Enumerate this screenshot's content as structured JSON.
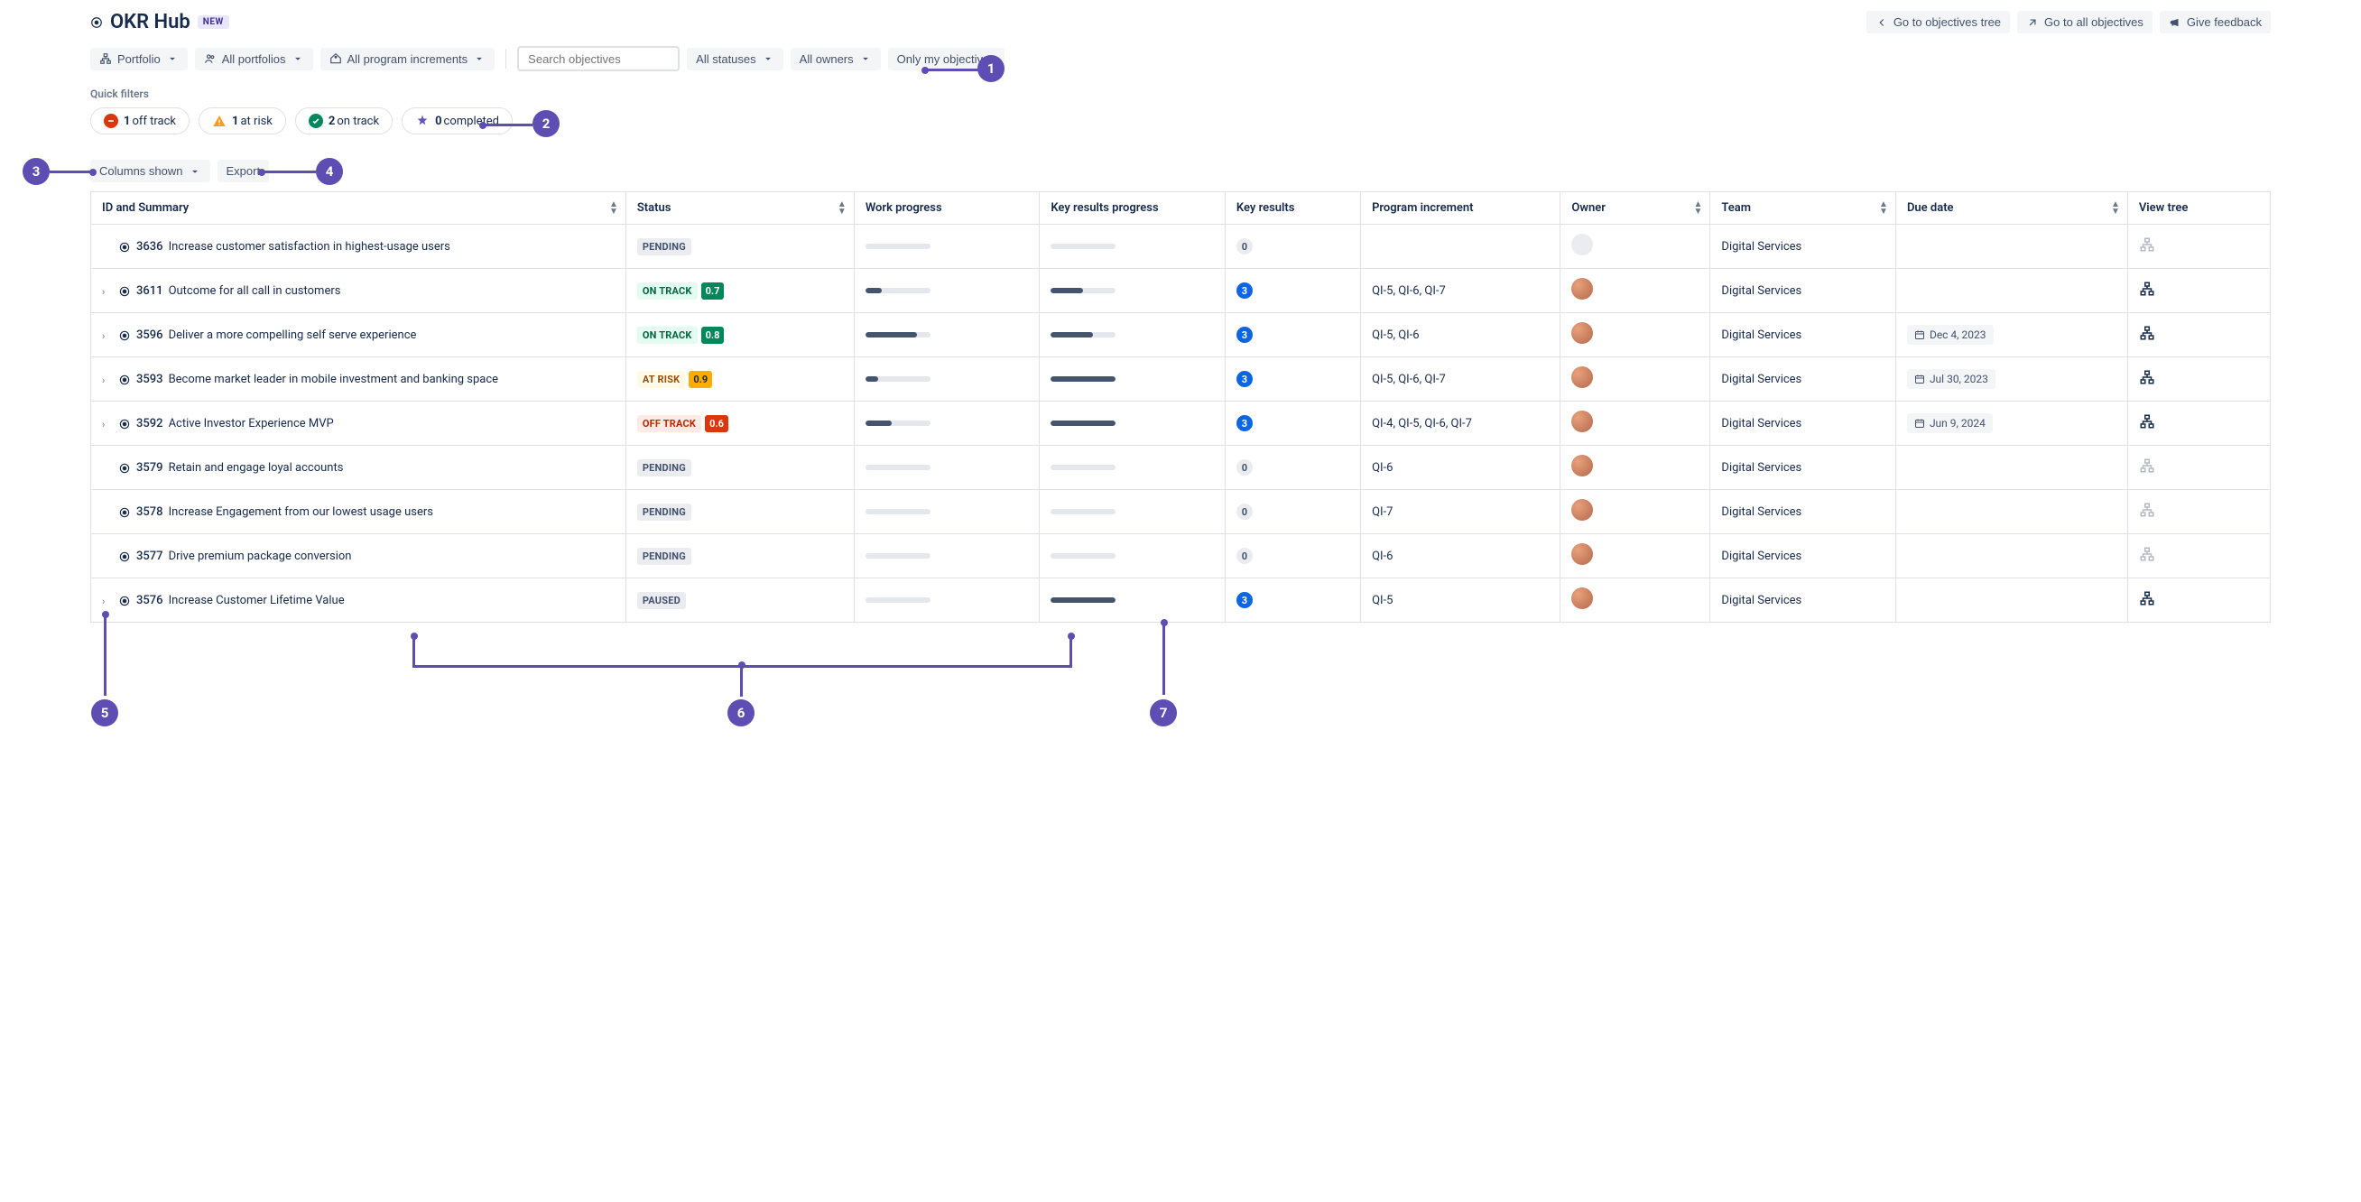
{
  "header": {
    "title": "OKR Hub",
    "new_badge": "NEW",
    "actions": {
      "objectives_tree": "Go to objectives tree",
      "all_objectives": "Go to all objectives",
      "feedback": "Give feedback"
    }
  },
  "filters": {
    "portfolio": "Portfolio",
    "all_portfolios": "All portfolios",
    "all_program_increments": "All program increments",
    "search_placeholder": "Search objectives",
    "all_statuses": "All statuses",
    "all_owners": "All owners",
    "only_my_objectives": "Only my objectives"
  },
  "quick_filters_label": "Quick filters",
  "quick_filters": {
    "off_track": {
      "count": "1",
      "label": "off track"
    },
    "at_risk": {
      "count": "1",
      "label": "at risk"
    },
    "on_track": {
      "count": "2",
      "label": "on track"
    },
    "completed": {
      "count": "0",
      "label": "completed"
    }
  },
  "table_controls": {
    "columns_shown": "Columns shown",
    "export": "Export"
  },
  "columns": {
    "id_summary": "ID and Summary",
    "status": "Status",
    "work_progress": "Work progress",
    "kr_progress": "Key results progress",
    "key_results": "Key results",
    "program_increment": "Program increment",
    "owner": "Owner",
    "team": "Team",
    "due_date": "Due date",
    "view_tree": "View tree"
  },
  "rows": [
    {
      "expandable": false,
      "id": "3636",
      "summary": "Increase customer satisfaction in highest-usage users",
      "status": "PENDING",
      "status_class": "st-pending",
      "score": "",
      "score_class": "",
      "work_progress": 0,
      "kr_progress": 0,
      "kr_count": "0",
      "kr_class": "kr-grey",
      "pi": "",
      "owner": "unassigned",
      "team": "Digital Services",
      "due": "",
      "tree_active": false
    },
    {
      "expandable": true,
      "id": "3611",
      "summary": "Outcome for all call in customers",
      "status": "ON TRACK",
      "status_class": "st-ontrack",
      "score": "0.7",
      "score_class": "sc-green",
      "work_progress": 25,
      "kr_progress": 50,
      "kr_count": "3",
      "kr_class": "kr-blue",
      "pi": "QI-5, QI-6, QI-7",
      "owner": "assigned",
      "team": "Digital Services",
      "due": "",
      "tree_active": true
    },
    {
      "expandable": true,
      "id": "3596",
      "summary": "Deliver a more compelling self serve experience",
      "status": "ON TRACK",
      "status_class": "st-ontrack",
      "score": "0.8",
      "score_class": "sc-green",
      "work_progress": 80,
      "kr_progress": 65,
      "kr_count": "3",
      "kr_class": "kr-blue",
      "pi": "QI-5, QI-6",
      "owner": "assigned",
      "team": "Digital Services",
      "due": "Dec 4, 2023",
      "tree_active": true
    },
    {
      "expandable": true,
      "id": "3593",
      "summary": "Become market leader in mobile investment and banking space",
      "status": "AT RISK",
      "status_class": "st-atrisk",
      "score": "0.9",
      "score_class": "sc-yellow",
      "work_progress": 20,
      "kr_progress": 100,
      "kr_count": "3",
      "kr_class": "kr-blue",
      "pi": "QI-5, QI-6, QI-7",
      "owner": "assigned",
      "team": "Digital Services",
      "due": "Jul 30, 2023",
      "tree_active": true
    },
    {
      "expandable": true,
      "id": "3592",
      "summary": "Active Investor Experience MVP",
      "status": "OFF TRACK",
      "status_class": "st-offtrack",
      "score": "0.6",
      "score_class": "sc-red",
      "work_progress": 40,
      "kr_progress": 100,
      "kr_count": "3",
      "kr_class": "kr-blue",
      "pi": "QI-4, QI-5, QI-6, QI-7",
      "owner": "assigned",
      "team": "Digital Services",
      "due": "Jun 9, 2024",
      "tree_active": true
    },
    {
      "expandable": false,
      "id": "3579",
      "summary": "Retain and engage loyal accounts",
      "status": "PENDING",
      "status_class": "st-pending",
      "score": "",
      "score_class": "",
      "work_progress": 0,
      "kr_progress": 0,
      "kr_count": "0",
      "kr_class": "kr-grey",
      "pi": "QI-6",
      "owner": "assigned",
      "team": "Digital Services",
      "due": "",
      "tree_active": false
    },
    {
      "expandable": false,
      "id": "3578",
      "summary": "Increase Engagement from our lowest usage users",
      "status": "PENDING",
      "status_class": "st-pending",
      "score": "",
      "score_class": "",
      "work_progress": 0,
      "kr_progress": 0,
      "kr_count": "0",
      "kr_class": "kr-grey",
      "pi": "QI-7",
      "owner": "assigned",
      "team": "Digital Services",
      "due": "",
      "tree_active": false
    },
    {
      "expandable": false,
      "id": "3577",
      "summary": "Drive premium package conversion",
      "status": "PENDING",
      "status_class": "st-pending",
      "score": "",
      "score_class": "",
      "work_progress": 0,
      "kr_progress": 0,
      "kr_count": "0",
      "kr_class": "kr-grey",
      "pi": "QI-6",
      "owner": "assigned",
      "team": "Digital Services",
      "due": "",
      "tree_active": false
    },
    {
      "expandable": true,
      "id": "3576",
      "summary": "Increase Customer Lifetime Value",
      "status": "PAUSED",
      "status_class": "st-paused",
      "score": "",
      "score_class": "",
      "work_progress": 0,
      "kr_progress": 100,
      "kr_count": "3",
      "kr_class": "kr-blue",
      "pi": "QI-5",
      "owner": "assigned",
      "team": "Digital Services",
      "due": "",
      "tree_active": true
    }
  ],
  "annotations": {
    "c1": "1",
    "c2": "2",
    "c3": "3",
    "c4": "4",
    "c5": "5",
    "c6": "6",
    "c7": "7"
  }
}
